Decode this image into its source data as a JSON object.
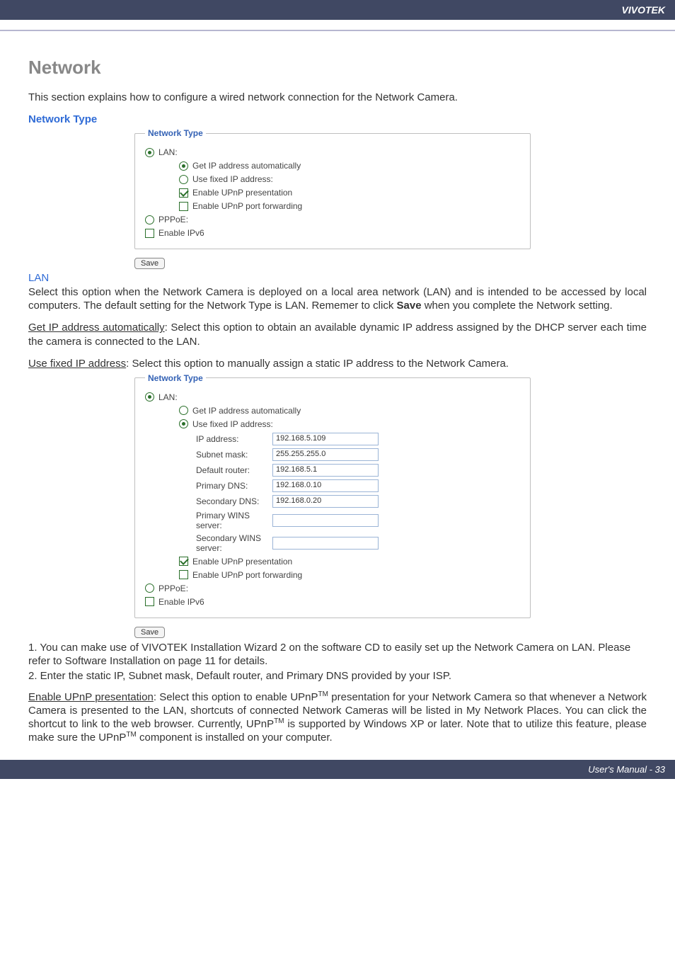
{
  "header": {
    "brand": "VIVOTEK"
  },
  "title": "Network",
  "intro": "This section explains how to configure a wired network connection for the Network Camera.",
  "section_network_type": "Network Type",
  "fieldset1": {
    "legend": "Network Type",
    "lan": "LAN:",
    "get_ip": "Get IP address automatically",
    "use_fixed": "Use fixed IP address:",
    "upnp_pres": "Enable UPnP presentation",
    "upnp_port": "Enable UPnP port forwarding",
    "pppoe": "PPPoE:",
    "ipv6": "Enable IPv6"
  },
  "save_label": "Save",
  "lan_heading": "LAN",
  "lan_para": "Select this option when the Network Camera is deployed on a local area network (LAN) and is intended to be accessed by local computers. The default setting for the Network Type is LAN. Rememer to click ",
  "lan_para_bold": "Save",
  "lan_para_tail": " when you complete the Network setting.",
  "get_ip_head": "Get IP address automatically",
  "get_ip_tail": ": Select this option to obtain an available dynamic IP address assigned by the DHCP server each time the camera is connected to the LAN.",
  "use_fixed_head": "Use fixed IP address",
  "use_fixed_tail": ": Select this option to manually assign a static IP address to the Network Camera.",
  "fieldset2": {
    "legend": "Network Type",
    "lan": "LAN:",
    "get_ip": "Get IP address automatically",
    "use_fixed": "Use fixed IP address:",
    "labels": {
      "ip": "IP address:",
      "subnet": "Subnet mask:",
      "router": "Default router:",
      "pdns": "Primary DNS:",
      "sdns": "Secondary DNS:",
      "pwins": "Primary WINS server:",
      "swins": "Secondary WINS server:"
    },
    "values": {
      "ip": "192.168.5.109",
      "subnet": "255.255.255.0",
      "router": "192.168.5.1",
      "pdns": "192.168.0.10",
      "sdns": "192.168.0.20",
      "pwins": "",
      "swins": ""
    },
    "upnp_pres": "Enable UPnP presentation",
    "upnp_port": "Enable UPnP port forwarding",
    "pppoe": "PPPoE:",
    "ipv6": "Enable IPv6"
  },
  "list": {
    "item1": "1. You can make use of VIVOTEK Installation Wizard 2 on the software CD to easily set up the Network Camera on LAN. Please refer to Software Installation on page 11 for details.",
    "item2": "2. Enter the static IP, Subnet mask, Default router, and Primary DNS provided by your ISP."
  },
  "upnp_head": "Enable UPnP presentation",
  "upnp_body_a": ": Select this option to enable UPnP",
  "upnp_tm": "TM",
  "upnp_body_b": " presentation for your Network Camera so that whenever a Network Camera is presented to the LAN, shortcuts of connected Network Cameras will be listed in My Network Places. You can click the shortcut to link to the web browser. Currently, UPnP",
  "upnp_body_c": " is supported by Windows XP or later. Note that to utilize this feature, please make sure the UPnP",
  "upnp_body_d": " component is installed on your computer.",
  "footer": "User's Manual - 33"
}
